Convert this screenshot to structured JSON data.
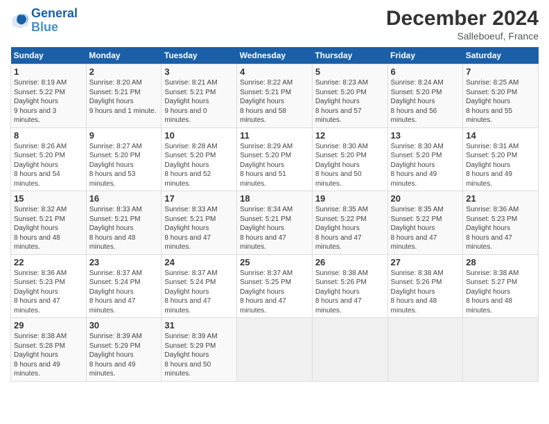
{
  "logo": {
    "line1": "General",
    "line2": "Blue"
  },
  "title": "December 2024",
  "subtitle": "Salleboeuf, France",
  "header_color": "#1a5fa8",
  "days_of_week": [
    "Sunday",
    "Monday",
    "Tuesday",
    "Wednesday",
    "Thursday",
    "Friday",
    "Saturday"
  ],
  "weeks": [
    [
      {
        "day": "1",
        "sunrise": "8:19 AM",
        "sunset": "5:22 PM",
        "daylight": "9 hours and 3 minutes."
      },
      {
        "day": "2",
        "sunrise": "8:20 AM",
        "sunset": "5:21 PM",
        "daylight": "9 hours and 1 minute."
      },
      {
        "day": "3",
        "sunrise": "8:21 AM",
        "sunset": "5:21 PM",
        "daylight": "9 hours and 0 minutes."
      },
      {
        "day": "4",
        "sunrise": "8:22 AM",
        "sunset": "5:21 PM",
        "daylight": "8 hours and 58 minutes."
      },
      {
        "day": "5",
        "sunrise": "8:23 AM",
        "sunset": "5:20 PM",
        "daylight": "8 hours and 57 minutes."
      },
      {
        "day": "6",
        "sunrise": "8:24 AM",
        "sunset": "5:20 PM",
        "daylight": "8 hours and 56 minutes."
      },
      {
        "day": "7",
        "sunrise": "8:25 AM",
        "sunset": "5:20 PM",
        "daylight": "8 hours and 55 minutes."
      }
    ],
    [
      {
        "day": "8",
        "sunrise": "8:26 AM",
        "sunset": "5:20 PM",
        "daylight": "8 hours and 54 minutes."
      },
      {
        "day": "9",
        "sunrise": "8:27 AM",
        "sunset": "5:20 PM",
        "daylight": "8 hours and 53 minutes."
      },
      {
        "day": "10",
        "sunrise": "8:28 AM",
        "sunset": "5:20 PM",
        "daylight": "8 hours and 52 minutes."
      },
      {
        "day": "11",
        "sunrise": "8:29 AM",
        "sunset": "5:20 PM",
        "daylight": "8 hours and 51 minutes."
      },
      {
        "day": "12",
        "sunrise": "8:30 AM",
        "sunset": "5:20 PM",
        "daylight": "8 hours and 50 minutes."
      },
      {
        "day": "13",
        "sunrise": "8:30 AM",
        "sunset": "5:20 PM",
        "daylight": "8 hours and 49 minutes."
      },
      {
        "day": "14",
        "sunrise": "8:31 AM",
        "sunset": "5:20 PM",
        "daylight": "8 hours and 49 minutes."
      }
    ],
    [
      {
        "day": "15",
        "sunrise": "8:32 AM",
        "sunset": "5:21 PM",
        "daylight": "8 hours and 48 minutes."
      },
      {
        "day": "16",
        "sunrise": "8:33 AM",
        "sunset": "5:21 PM",
        "daylight": "8 hours and 48 minutes."
      },
      {
        "day": "17",
        "sunrise": "8:33 AM",
        "sunset": "5:21 PM",
        "daylight": "8 hours and 47 minutes."
      },
      {
        "day": "18",
        "sunrise": "8:34 AM",
        "sunset": "5:21 PM",
        "daylight": "8 hours and 47 minutes."
      },
      {
        "day": "19",
        "sunrise": "8:35 AM",
        "sunset": "5:22 PM",
        "daylight": "8 hours and 47 minutes."
      },
      {
        "day": "20",
        "sunrise": "8:35 AM",
        "sunset": "5:22 PM",
        "daylight": "8 hours and 47 minutes."
      },
      {
        "day": "21",
        "sunrise": "8:36 AM",
        "sunset": "5:23 PM",
        "daylight": "8 hours and 47 minutes."
      }
    ],
    [
      {
        "day": "22",
        "sunrise": "8:36 AM",
        "sunset": "5:23 PM",
        "daylight": "8 hours and 47 minutes."
      },
      {
        "day": "23",
        "sunrise": "8:37 AM",
        "sunset": "5:24 PM",
        "daylight": "8 hours and 47 minutes."
      },
      {
        "day": "24",
        "sunrise": "8:37 AM",
        "sunset": "5:24 PM",
        "daylight": "8 hours and 47 minutes."
      },
      {
        "day": "25",
        "sunrise": "8:37 AM",
        "sunset": "5:25 PM",
        "daylight": "8 hours and 47 minutes."
      },
      {
        "day": "26",
        "sunrise": "8:38 AM",
        "sunset": "5:26 PM",
        "daylight": "8 hours and 47 minutes."
      },
      {
        "day": "27",
        "sunrise": "8:38 AM",
        "sunset": "5:26 PM",
        "daylight": "8 hours and 48 minutes."
      },
      {
        "day": "28",
        "sunrise": "8:38 AM",
        "sunset": "5:27 PM",
        "daylight": "8 hours and 48 minutes."
      }
    ],
    [
      {
        "day": "29",
        "sunrise": "8:38 AM",
        "sunset": "5:28 PM",
        "daylight": "8 hours and 49 minutes."
      },
      {
        "day": "30",
        "sunrise": "8:39 AM",
        "sunset": "5:29 PM",
        "daylight": "8 hours and 49 minutes."
      },
      {
        "day": "31",
        "sunrise": "8:39 AM",
        "sunset": "5:29 PM",
        "daylight": "8 hours and 50 minutes."
      },
      null,
      null,
      null,
      null
    ]
  ]
}
